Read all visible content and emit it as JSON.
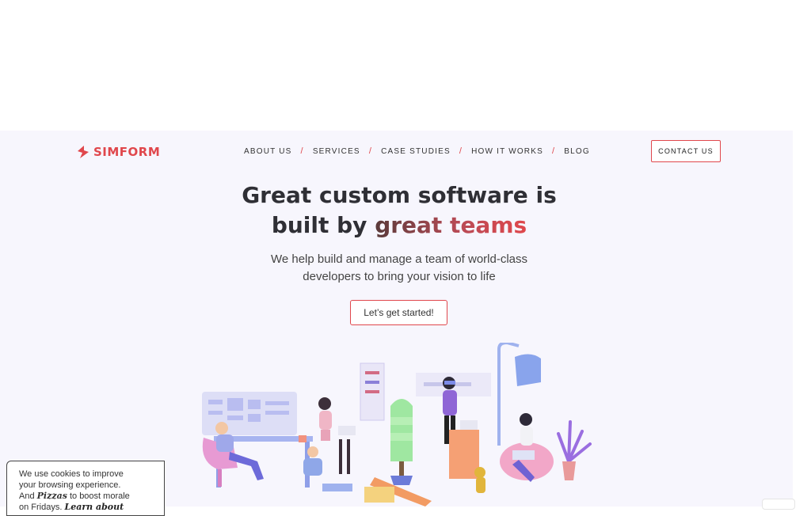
{
  "brand": {
    "name": "SIMFORM",
    "accent": "#e0474c"
  },
  "nav": {
    "items": [
      {
        "label": "ABOUT US"
      },
      {
        "label": "SERVICES"
      },
      {
        "label": "CASE STUDIES"
      },
      {
        "label": "HOW IT WORKS"
      },
      {
        "label": "BLOG"
      }
    ],
    "separator": "/"
  },
  "header": {
    "contact_label": "CONTACT US"
  },
  "hero": {
    "headline_line1": "Great custom software is",
    "headline_line2_plain": "built by ",
    "headline_line2_accent": "great teams",
    "subtitle_line1": "We help build and manage a team of world-class",
    "subtitle_line2": "developers to bring your vision to life",
    "cta_label": "Let’s get started!"
  },
  "cookie": {
    "line1": "We use cookies to improve",
    "line2": "your browsing experience.",
    "line3_prefix": "And ",
    "line3_emphasis": "Pizzas",
    "line3_suffix": " to boost morale",
    "line4_prefix": "on Fridays. ",
    "line4_link": "Learn about"
  },
  "icons": [
    "simform-logo-icon",
    "team-illustration"
  ]
}
